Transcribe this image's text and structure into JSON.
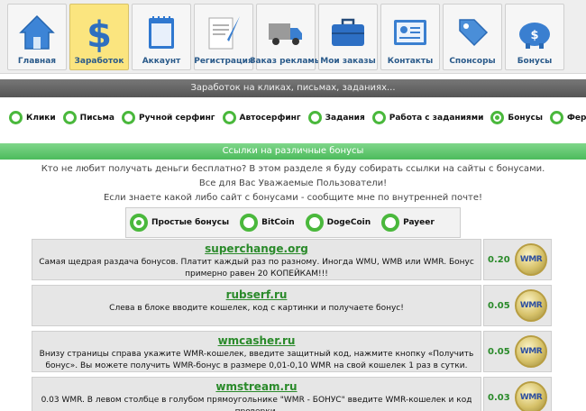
{
  "nav": [
    {
      "label": "Главная",
      "icon": "home-icon"
    },
    {
      "label": "Заработок",
      "icon": "dollar-icon",
      "active": true
    },
    {
      "label": "Аккаунт",
      "icon": "notepad-icon"
    },
    {
      "label": "Регистрация",
      "icon": "document-quill-icon"
    },
    {
      "label": "Заказ рекламы",
      "icon": "truck-icon"
    },
    {
      "label": "Мои заказы",
      "icon": "briefcase-icon"
    },
    {
      "label": "Контакты",
      "icon": "contact-card-icon"
    },
    {
      "label": "Спонсоры",
      "icon": "tag-icon"
    },
    {
      "label": "Бонусы",
      "icon": "piggy-bank-icon"
    }
  ],
  "earn_header": "Заработок на кликах, письмах, заданиях...",
  "earn_filters": [
    {
      "label": "Клики",
      "selected": false
    },
    {
      "label": "Письма",
      "selected": false
    },
    {
      "label": "Ручной серфинг",
      "selected": false
    },
    {
      "label": "Автосерфинг",
      "selected": false
    },
    {
      "label": "Задания",
      "selected": false
    },
    {
      "label": "Работа с заданиями",
      "selected": false
    },
    {
      "label": "Бонусы",
      "selected": true
    },
    {
      "label": "Ферма",
      "selected": false
    }
  ],
  "bonus_header": "Ссылки на различные бонусы",
  "intro": {
    "line1": "Кто не любит получать деньги бесплатно? В этом разделе я буду собирать ссылки на сайты с бонусами.",
    "line2": "Все для Вас Уважаемые Пользователи!",
    "line3": "Если знаете какой либо сайт с бонусами - сообщите мне по внутренней почте!"
  },
  "bonus_filters": [
    {
      "label": "Простые бонусы",
      "selected": true
    },
    {
      "label": "BitCoin",
      "selected": false
    },
    {
      "label": "DogeCoin",
      "selected": false
    },
    {
      "label": "Payeer",
      "selected": false
    }
  ],
  "sites": [
    {
      "name": "superchange.org",
      "description": "Самая щедрая раздача бонусов. Платит каждый раз по разному. Иногда WMU, WMB или WMR. Бонус примерно равен 20 КОПЕЙКАМ!!!",
      "amount": "0.20",
      "currency": "WMR"
    },
    {
      "name": "rubserf.ru",
      "description": "Слева в блоке вводите кошелек, код с картинки и получаете бонус!",
      "amount": "0.05",
      "currency": "WMR"
    },
    {
      "name": "wmcasher.ru",
      "description": "Внизу страницы справа укажите WMR-кошелек, введите защитный код, нажмите кнопку «Получить бонус». Вы можете получить WMR-бонус в размере 0,01-0,10 WMR на свой кошелек 1 раз в сутки.",
      "amount": "0.05",
      "currency": "WMR"
    },
    {
      "name": "wmstream.ru",
      "description": "0.03 WMR. В левом столбце в голубом прямоугольнике \"WMR - БОНУС\" введите WMR-кошелек и код проверки.",
      "amount": "0.03",
      "currency": "WMR"
    }
  ]
}
